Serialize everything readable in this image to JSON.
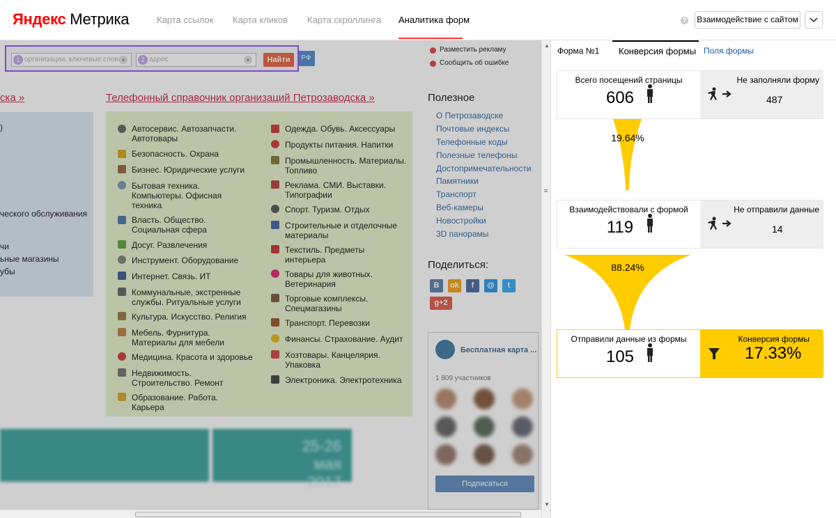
{
  "header": {
    "logo_brand": "Яндекс",
    "logo_product": "Метрика",
    "nav": [
      "Карта ссылок",
      "Карта кликов",
      "Карта скроллинга",
      "Аналитика форм"
    ],
    "active_nav": "Аналитика форм",
    "help_glyph": "?",
    "interaction_button": "Взаимодействие с сайтом"
  },
  "site": {
    "search": {
      "placeholder1": "организации, ключевые слова",
      "placeholder2": "адрес",
      "button": "Найти",
      "badge1": "1",
      "badge2": "2",
      "clear": "×",
      "extra": "РФ"
    },
    "top_links": [
      "Разместить рекламу",
      "Сообщить об ошибке"
    ],
    "left_heading": "ска »",
    "main_heading": "Телефонный справочник организаций Петрозаводска »",
    "left_fragments": [
      ")",
      "ческого обслуживания",
      "чи",
      "ьные магазины",
      "убы"
    ],
    "categories_col1": [
      "Автосервис. Автозапчасти. Автотовары",
      "Безопасность. Охрана",
      "Бизнес. Юридические услуги",
      "Бытовая техника. Компьютеры. Офисная техника",
      "Власть. Общество. Социальная сфера",
      "Досуг. Развлечения",
      "Инструмент. Оборудование",
      "Интернет. Связь. ИТ",
      "Коммунальные, экстренные службы. Ритуальные услуги",
      "Культура. Искусство. Религия",
      "Мебель. Фурнитура. Материалы для мебели",
      "Медицина. Красота и здоровье",
      "Недвижимость. Строительство. Ремонт",
      "Образование. Работа. Карьера"
    ],
    "categories_col2": [
      "Одежда. Обувь. Аксессуары",
      "Продукты питания. Напитки",
      "Промышленность. Материалы. Топливо",
      "Реклама. СМИ. Выставки. Типографии",
      "Спорт. Туризм. Отдых",
      "Строительные и отделочные материалы",
      "Текстиль. Предметы интерьера",
      "Товары для животных. Ветеринария",
      "Торговые комплексы. Спецмагазины",
      "Транспорт. Перевозки",
      "Финансы. Страхование. Аудит",
      "Хозтовары. Канцелярия. Упаковка",
      "Электроника. Электротехника"
    ],
    "useful_title": "Полезное",
    "useful_links": [
      "О Петрозаводске",
      "Почтовые индексы",
      "Телефонные коды",
      "Полезные телефоны",
      "Достопримечательности",
      "Памятники",
      "Транспорт",
      "Веб-камеры",
      "Новостройки",
      "3D панорамы"
    ],
    "share_title": "Поделиться:",
    "social": [
      "В",
      "ok",
      "f",
      "@",
      "t",
      "g+2"
    ],
    "vk_group": {
      "title": "Бесплатная карта ...",
      "members": "1 809 участников",
      "subscribe": "Подписаться"
    },
    "banner_text": "25-26 мая 2017"
  },
  "panel": {
    "tabs": [
      "Форма №1",
      "Конверсия формы",
      "Поля формы"
    ],
    "active_tab": "Конверсия формы",
    "stages": [
      {
        "label": "Всего посещений страницы",
        "value": "606",
        "right_label": "Не заполняли форму",
        "right_value": "487"
      },
      {
        "label": "Взаимодействовали с формой",
        "value": "119",
        "right_label": "Не отправили данные",
        "right_value": "14"
      },
      {
        "label": "Отправили данные из формы",
        "value": "105",
        "right_label": "Конверсия формы",
        "right_value": "17.33%"
      }
    ],
    "funnel_pcts": [
      "19.64%",
      "88.24%"
    ],
    "colors": {
      "accent": "#ffcc00",
      "tab_underline": "#f33",
      "link": "#1a5a9c",
      "heading_red": "#c8102e"
    }
  }
}
